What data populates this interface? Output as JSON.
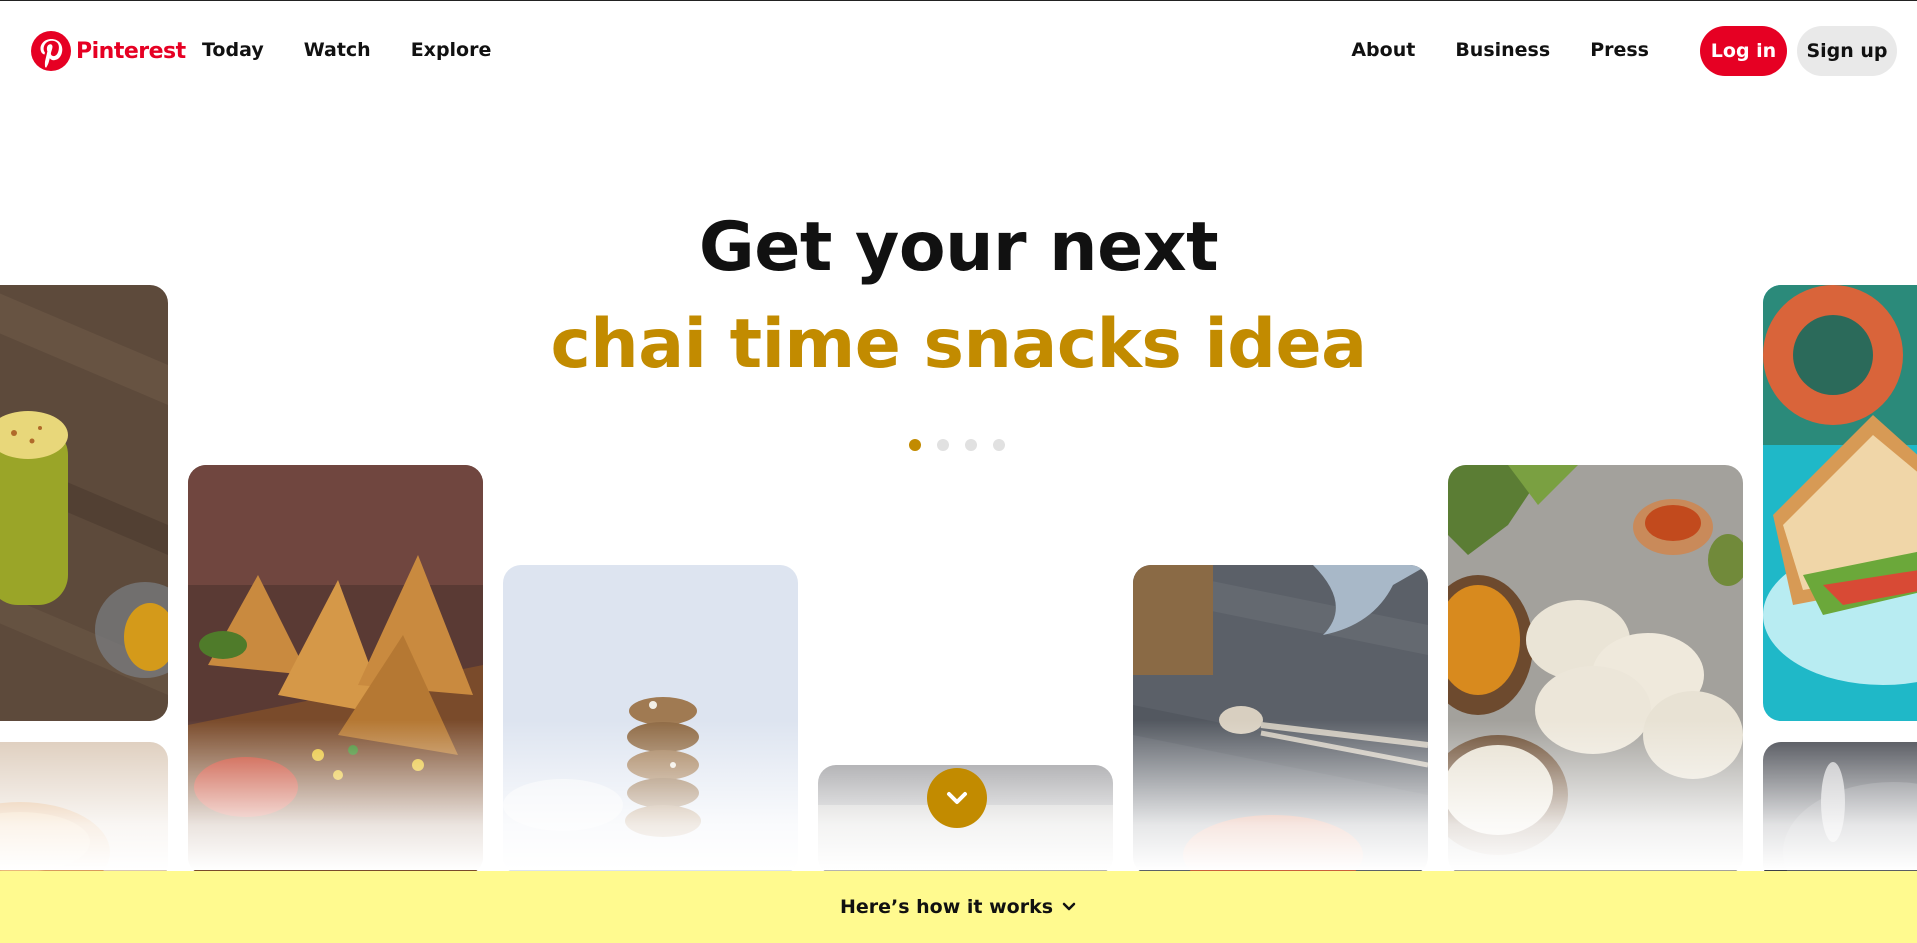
{
  "brand": {
    "name": "Pinterest",
    "color": "#e60023"
  },
  "nav_left": [
    "Today",
    "Watch",
    "Explore"
  ],
  "nav_right": [
    "About",
    "Business",
    "Press"
  ],
  "buttons": {
    "login": "Log in",
    "signup": "Sign up"
  },
  "hero": {
    "line1": "Get your next",
    "line2": "chai time snacks idea",
    "accent_color": "#c28b00",
    "carousel": {
      "total": 4,
      "active": 1
    }
  },
  "cards": [
    {
      "name": "lassi-drink-image",
      "icon": "drink-glass"
    },
    {
      "name": "bread-roll-image",
      "icon": "bread"
    },
    {
      "name": "samosa-image",
      "icon": "samosa"
    },
    {
      "name": "oat-cookies-image",
      "icon": "cookies"
    },
    {
      "name": "tray-image",
      "icon": "tray"
    },
    {
      "name": "pav-bhaji-image",
      "icon": "spoons"
    },
    {
      "name": "idli-image",
      "icon": "idli"
    },
    {
      "name": "sandwich-image",
      "icon": "sandwich"
    },
    {
      "name": "kitchen-pan-image",
      "icon": "pan"
    }
  ],
  "scroll_icon": "chevron-down-icon",
  "footer_bar": {
    "label": "Here’s how it works",
    "color": "#fffa8f"
  }
}
